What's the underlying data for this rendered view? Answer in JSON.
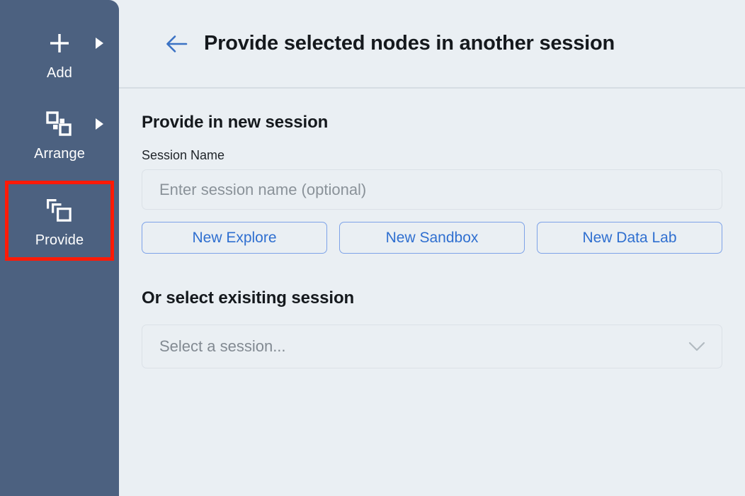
{
  "sidebar": {
    "items": [
      {
        "label": "Add",
        "icon": "plus-icon",
        "has_caret": true,
        "highlighted": false
      },
      {
        "label": "Arrange",
        "icon": "arrange-nodes-icon",
        "has_caret": true,
        "highlighted": false
      },
      {
        "label": "Provide",
        "icon": "stacked-layers-icon",
        "has_caret": false,
        "highlighted": true
      }
    ],
    "background_color": "#4c6180",
    "highlight_color": "#ff1a07"
  },
  "header": {
    "back_icon": "arrow-left-icon",
    "title": "Provide selected nodes in another session",
    "accent_color": "#3b72c4"
  },
  "main": {
    "new_session": {
      "section_title": "Provide in new session",
      "session_name_label": "Session Name",
      "session_name_value": "",
      "session_name_placeholder": "Enter session name (optional)",
      "buttons": [
        {
          "label": "New Explore"
        },
        {
          "label": "New Sandbox"
        },
        {
          "label": "New Data Lab"
        }
      ],
      "button_text_color": "#2f6fd0",
      "button_border_color": "#7da2e8"
    },
    "existing_session": {
      "section_title": "Or select exisiting session",
      "select_placeholder": "Select a session...",
      "chevron_icon": "chevron-down-icon"
    }
  }
}
